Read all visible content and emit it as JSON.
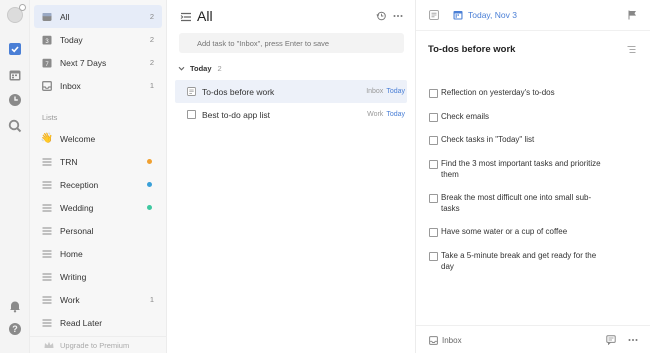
{
  "colors": {
    "accent": "#4a7fd6",
    "checkbox_active": "#4a7fd6"
  },
  "rail": {
    "icons": [
      "avatar",
      "checkbox-icon",
      "calendar-icon",
      "clock-icon",
      "search-icon",
      "bell-icon",
      "help-icon"
    ]
  },
  "sidebar": {
    "smart_lists": [
      {
        "label": "All",
        "count": "2",
        "icon": "all-icon"
      },
      {
        "label": "Today",
        "count": "2",
        "icon": "today-icon"
      },
      {
        "label": "Next 7 Days",
        "count": "2",
        "icon": "next7-icon"
      },
      {
        "label": "Inbox",
        "count": "1",
        "icon": "inbox-icon"
      }
    ],
    "lists_heading": "Lists",
    "lists": [
      {
        "label": "Welcome",
        "emoji": "👋",
        "dot": "",
        "count": ""
      },
      {
        "label": "TRN",
        "dot": "#f0a030",
        "count": ""
      },
      {
        "label": "Reception",
        "dot": "#3aa0d8",
        "count": ""
      },
      {
        "label": "Wedding",
        "dot": "#3ec8a0",
        "count": ""
      },
      {
        "label": "Personal",
        "dot": "",
        "count": ""
      },
      {
        "label": "Home",
        "dot": "",
        "count": ""
      },
      {
        "label": "Writing",
        "dot": "",
        "count": ""
      },
      {
        "label": "Work",
        "dot": "",
        "count": "1"
      },
      {
        "label": "Read Later",
        "dot": "",
        "count": ""
      }
    ],
    "upgrade_label": "Upgrade to Premium"
  },
  "tasklist": {
    "title": "All",
    "add_placeholder": "Add task to \"Inbox\", press Enter to save",
    "section": {
      "title": "Today",
      "count": "2"
    },
    "tasks": [
      {
        "title": "To-dos before work",
        "project": "Inbox",
        "date": "Today"
      },
      {
        "title": "Best to-do app list",
        "project": "Work",
        "date": "Today"
      }
    ]
  },
  "detail": {
    "date": "Today, Nov 3",
    "title": "To-dos before work",
    "subtasks": [
      "Reflection on yesterday's to-dos",
      "Check emails",
      "Check tasks in \"Today\" list",
      "Find the 3 most important tasks and prioritize them",
      "Break the most difficult one into small sub-tasks",
      "Have some water or a cup of coffee",
      "Take a 5-minute break and get ready for the day"
    ],
    "project": "Inbox"
  }
}
